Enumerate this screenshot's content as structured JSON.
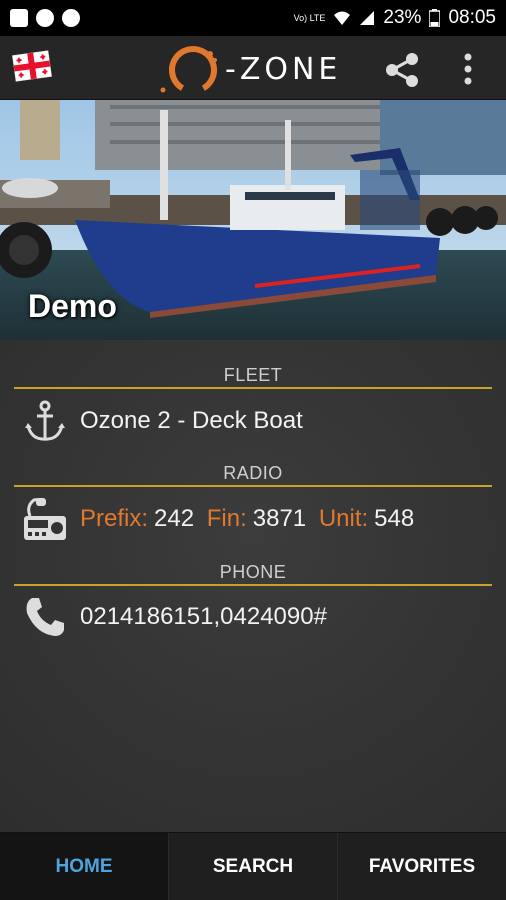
{
  "status_bar": {
    "network_label": "Vo) LTE",
    "battery_percent": "23%",
    "time": "08:05"
  },
  "app_bar": {
    "logo_text": "-ZONE",
    "flag_icon": "georgia-flag-icon",
    "share_icon": "share-icon",
    "menu_icon": "overflow-menu-icon"
  },
  "hero": {
    "title": "Demo"
  },
  "sections": {
    "fleet": {
      "heading": "FLEET",
      "value": "Ozone 2 - Deck Boat",
      "icon": "anchor-icon"
    },
    "radio": {
      "heading": "RADIO",
      "prefix_label": "Prefix:",
      "prefix_value": "242",
      "fin_label": "Fin:",
      "fin_value": "3871",
      "unit_label": "Unit:",
      "unit_value": "548",
      "icon": "radio-icon"
    },
    "phone": {
      "heading": "PHONE",
      "value": "0214186151,0424090#",
      "icon": "phone-icon"
    }
  },
  "bottom_nav": {
    "tabs": [
      {
        "label": "HOME",
        "active": true
      },
      {
        "label": "SEARCH",
        "active": false
      },
      {
        "label": "FAVORITES",
        "active": false
      }
    ]
  },
  "colors": {
    "accent_orange": "#e0782e",
    "rule_gold": "#c9a227",
    "active_tab_blue": "#4fa3e0"
  }
}
